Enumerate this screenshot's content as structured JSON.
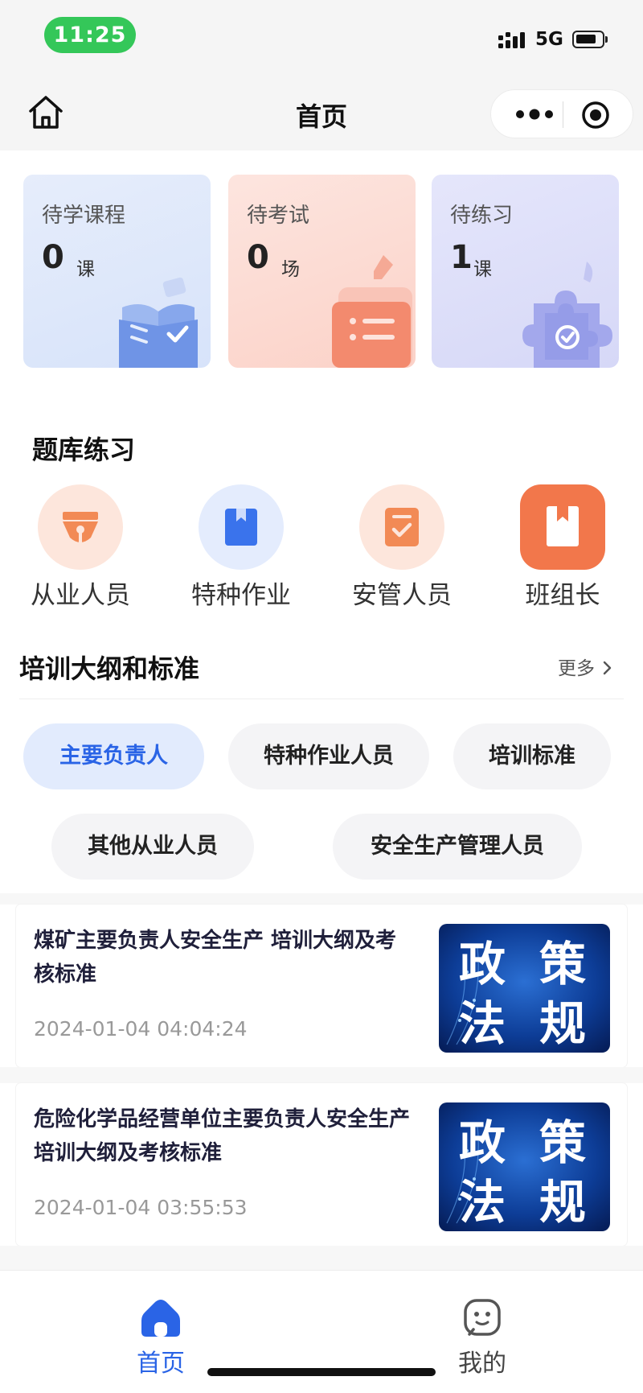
{
  "status_bar": {
    "time": "11:25",
    "network": "5G"
  },
  "nav": {
    "title": "首页"
  },
  "stats": [
    {
      "label": "待学课程",
      "count": "0",
      "unit": "课"
    },
    {
      "label": "待考试",
      "count": "0",
      "unit": "场"
    },
    {
      "label": "待练习",
      "count": "1",
      "unit": "课"
    }
  ],
  "practice": {
    "title": "题库练习",
    "items": [
      {
        "label": "从业人员",
        "icon": "pen-nib-icon"
      },
      {
        "label": "特种作业",
        "icon": "bookmark-book-icon"
      },
      {
        "label": "安管人员",
        "icon": "checklist-icon"
      },
      {
        "label": "班组长",
        "icon": "bookmark-book-icon"
      }
    ]
  },
  "training": {
    "title": "培训大纲和标准",
    "more": "更多",
    "chips": [
      "主要负责人",
      "特种作业人员",
      "培训标准",
      "其他从业人员",
      "安全生产管理人员"
    ],
    "active_chip": 0
  },
  "articles": [
    {
      "title": "煤矿主要负责人安全生产 培训大纲及考核标准",
      "time": "2024-01-04 04:04:24",
      "thumb_text": [
        "政",
        "策",
        "法",
        "规"
      ]
    },
    {
      "title": "危险化学品经营单位主要负责人安全生产培训大纲及考核标准",
      "time": "2024-01-04 03:55:53",
      "thumb_text": [
        "政",
        "策",
        "法",
        "规"
      ]
    }
  ],
  "tabbar": {
    "items": [
      {
        "label": "首页",
        "active": true
      },
      {
        "label": "我的",
        "active": false
      }
    ]
  },
  "colors": {
    "accent_blue": "#2a64e6",
    "status_green": "#34c759",
    "orange": "#f2774b"
  }
}
